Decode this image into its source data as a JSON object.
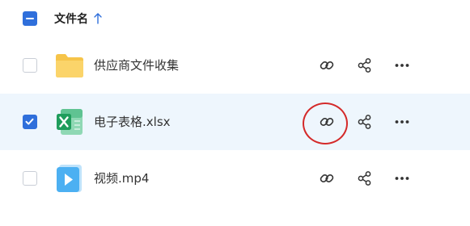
{
  "header": {
    "select_all_state": "partial",
    "column_label": "文件名",
    "sort": "ascending"
  },
  "files": [
    {
      "name": "供应商文件收集",
      "type": "folder",
      "icon": "folder-icon",
      "selected": false
    },
    {
      "name": "电子表格.xlsx",
      "type": "spreadsheet",
      "icon": "excel-icon",
      "selected": true
    },
    {
      "name": "视频.mp4",
      "type": "video",
      "icon": "video-icon",
      "selected": false
    }
  ],
  "actions": {
    "copy_link": "link-icon",
    "share": "share-icon",
    "more": "more-icon"
  },
  "colors": {
    "accent": "#2f6fdb",
    "selected_row": "#eef6fd",
    "annotation": "#d42a2a"
  }
}
